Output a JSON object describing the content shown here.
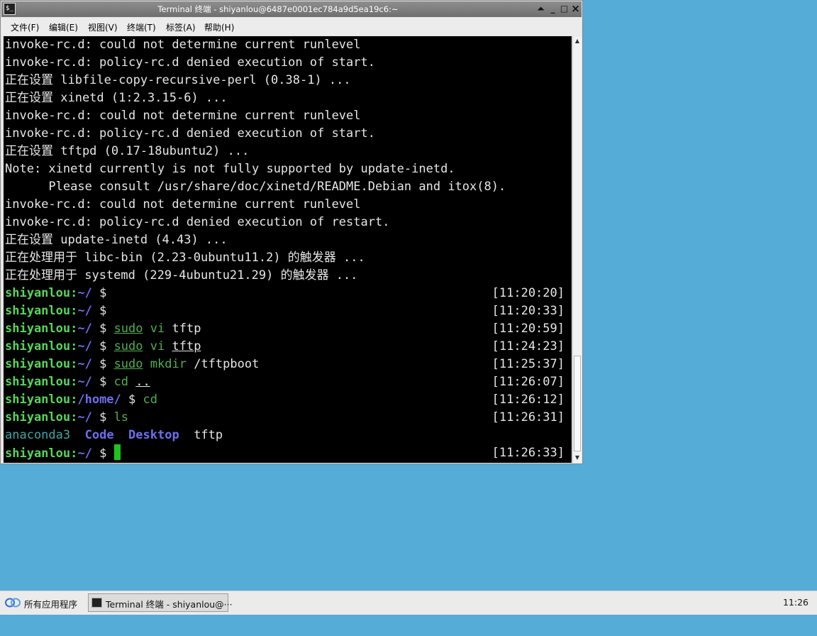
{
  "window": {
    "title": "Terminal 终端 - shiyanlou@6487e0001ec784a9d5ea19c6:~",
    "buttons": {
      "shade": "⏶",
      "minimize": "_",
      "maximize": "□",
      "close": "×"
    }
  },
  "menu": [
    "文件(F)",
    "编辑(E)",
    "视图(V)",
    "终端(T)",
    "标签(A)",
    "帮助(H)"
  ],
  "terminal": {
    "output": [
      "invoke-rc.d: could not determine current runlevel",
      "invoke-rc.d: policy-rc.d denied execution of start.",
      "正在设置 libfile-copy-recursive-perl (0.38-1) ...",
      "正在设置 xinetd (1:2.3.15-6) ...",
      "invoke-rc.d: could not determine current runlevel",
      "invoke-rc.d: policy-rc.d denied execution of start.",
      "正在设置 tftpd (0.17-18ubuntu2) ...",
      "Note: xinetd currently is not fully supported by update-inetd.",
      "      Please consult /usr/share/doc/xinetd/README.Debian and itox(8).",
      "invoke-rc.d: could not determine current runlevel",
      "invoke-rc.d: policy-rc.d denied execution of restart.",
      "正在设置 update-inetd (4.43) ...",
      "正在处理用于 libc-bin (2.23-0ubuntu11.2) 的触发器 ...",
      "正在处理用于 systemd (229-4ubuntu21.29) 的触发器 ..."
    ],
    "prompt_user": "shiyanlou:",
    "home_path": "~/",
    "dollar": " $ ",
    "commands": [
      {
        "path": "~/",
        "cmd": "",
        "arg1": "",
        "arg2": "",
        "time": "[11:20:20]"
      },
      {
        "path": "~/",
        "cmd": "",
        "arg1": "",
        "arg2": "",
        "time": "[11:20:33]"
      },
      {
        "path": "~/",
        "cmd": "sudo",
        "arg1": "vi",
        "arg2": "tftp",
        "time": "[11:20:59]"
      },
      {
        "path": "~/",
        "cmd": "sudo",
        "arg1": "vi",
        "arg2": "tftp",
        "time": "[11:24:23]"
      },
      {
        "path": "~/",
        "cmd": "sudo",
        "arg1": "mkdir",
        "arg2": "/tftpboot",
        "time": "[11:25:37]"
      },
      {
        "path": "~/",
        "cmd": "cd",
        "arg1": "..",
        "arg2": "",
        "time": "[11:26:07]"
      },
      {
        "path": "/home/",
        "cmd": "cd",
        "arg1": "",
        "arg2": "",
        "time": "[11:26:12]"
      },
      {
        "path": "~/",
        "cmd": "ls",
        "arg1": "",
        "arg2": "",
        "time": "[11:26:31]"
      }
    ],
    "ls_output": {
      "anaconda": "anaconda3",
      "code": "Code",
      "desktop": "Desktop",
      "tftp": "tftp"
    },
    "last_time": "[11:26:33]",
    "colors": {
      "user": "#57d657",
      "path": "#6e6ef0",
      "cmd": "#4fb04f",
      "cursor": "#1ec41e"
    }
  },
  "taskbar": {
    "start_label": "所有应用程序",
    "task_label": "Terminal 终端 - shiyanlou@···",
    "clock": "11:26"
  }
}
